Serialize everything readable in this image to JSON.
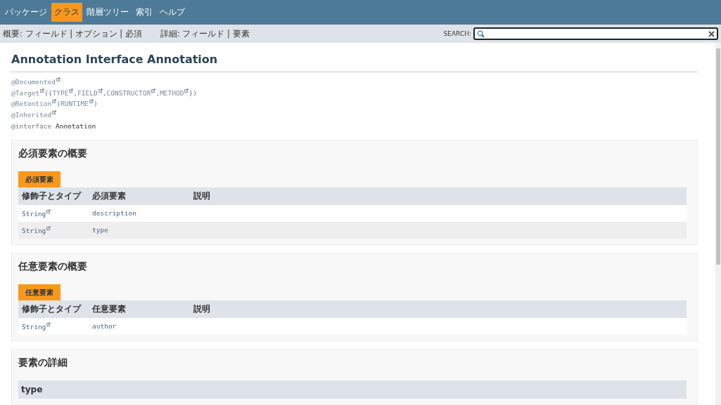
{
  "top_nav": [
    {
      "label": "パッケージ",
      "selected": false
    },
    {
      "label": "クラス",
      "selected": true
    },
    {
      "label": "階層ツリー",
      "selected": false
    },
    {
      "label": "索引",
      "selected": false
    },
    {
      "label": "ヘルプ",
      "selected": false
    }
  ],
  "sub_nav": {
    "summary": "概要: フィールド | オプション | 必須",
    "detail": "詳細: フィールド | 要素"
  },
  "search": {
    "label": "SEARCH:"
  },
  "title": "Annotation Interface Annotation",
  "signature": [
    [
      {
        "text": "@Documented",
        "link": true
      }
    ],
    [
      {
        "text": "@Target",
        "link": true
      },
      {
        "text": "({",
        "link": false
      },
      {
        "text": "TYPE",
        "link": true
      },
      {
        "text": ",",
        "link": false
      },
      {
        "text": "FIELD",
        "link": true
      },
      {
        "text": ",",
        "link": false
      },
      {
        "text": "CONSTRUCTOR",
        "link": true
      },
      {
        "text": ",",
        "link": false
      },
      {
        "text": "METHOD",
        "link": true
      },
      {
        "text": "})",
        "link": false
      }
    ],
    [
      {
        "text": "@Retention",
        "link": true
      },
      {
        "text": "(",
        "link": false
      },
      {
        "text": "RUNTIME",
        "link": true
      },
      {
        "text": ")",
        "link": false
      }
    ],
    [
      {
        "text": "@Inherited",
        "link": true
      }
    ],
    [
      {
        "text": "@interface",
        "link": false
      },
      {
        "text": "Annotation",
        "kind": "name"
      }
    ]
  ],
  "sections": [
    {
      "heading": "必須要素の概要",
      "caption": "必須要素",
      "columns": [
        "修飾子とタイプ",
        "必須要素",
        "説明"
      ],
      "rows": [
        [
          "String",
          "description"
        ],
        [
          "String",
          "type"
        ]
      ]
    },
    {
      "heading": "任意要素の概要",
      "caption": "任意要素",
      "columns": [
        "修飾子とタイプ",
        "任意要素",
        "説明"
      ],
      "rows": [
        [
          "String",
          "author"
        ]
      ]
    }
  ],
  "details": {
    "heading": "要素の詳細",
    "member": "type"
  }
}
